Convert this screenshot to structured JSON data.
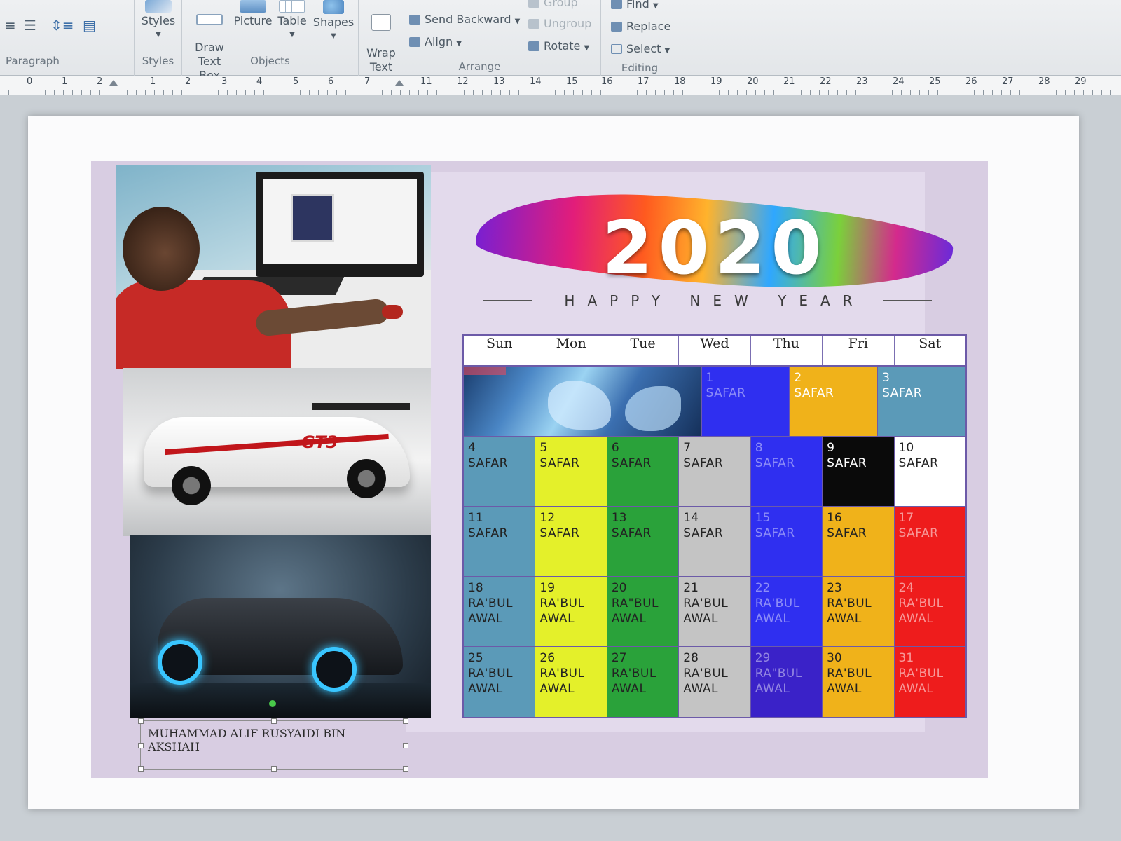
{
  "ribbon": {
    "paragraph": {
      "group_label": "Paragraph"
    },
    "styles": {
      "button_label": "Styles",
      "group_label": "Styles"
    },
    "objects": {
      "group_label": "Objects",
      "buttons": [
        {
          "label": "Draw\nText Box"
        },
        {
          "label": "Picture"
        },
        {
          "label": "Table"
        },
        {
          "label": "Shapes"
        }
      ]
    },
    "arrange": {
      "group_label": "Arrange",
      "wrap_text": "Wrap\nText",
      "send_backward": "Send Backward",
      "align": "Align",
      "group": "Group",
      "ungroup": "Ungroup",
      "rotate": "Rotate"
    },
    "editing": {
      "group_label": "Editing",
      "find": "Find",
      "replace": "Replace",
      "select": "Select"
    }
  },
  "ruler": {
    "numbers": [
      "0",
      "1",
      "2",
      "1",
      "2",
      "3",
      "4",
      "5",
      "6",
      "7",
      "11",
      "12",
      "13",
      "14",
      "15",
      "16",
      "17",
      "18",
      "19",
      "20",
      "21",
      "22",
      "23",
      "24",
      "25",
      "26",
      "27",
      "28",
      "29"
    ]
  },
  "banner": {
    "year": "2020",
    "subtitle": "HAPPY NEW YEAR"
  },
  "name_box": {
    "text": "MUHAMMAD ALIF RUSYAIDI BIN AKSHAH"
  },
  "calendar": {
    "days": [
      "Sun",
      "Mon",
      "Tue",
      "Wed",
      "Thu",
      "Fri",
      "Sat"
    ],
    "first_row": [
      {
        "day": "1",
        "month": "SAFAR",
        "color": "#2f2ff0"
      },
      {
        "day": "2",
        "month": "SAFAR",
        "color": "#f0b21a"
      },
      {
        "day": "3",
        "month": "SAFAR",
        "color": "#5b9ab8"
      }
    ],
    "rows": [
      [
        {
          "day": "4",
          "month": "SAFAR",
          "color": "#5b9ab8"
        },
        {
          "day": "5",
          "month": "SAFAR",
          "color": "#e4f02a"
        },
        {
          "day": "6",
          "month": "SAFAR",
          "color": "#2aa23a"
        },
        {
          "day": "7",
          "month": "SAFAR",
          "color": "#c4c4c4"
        },
        {
          "day": "8",
          "month": "SAFAR",
          "color": "#2f2ff0"
        },
        {
          "day": "9",
          "month": "SAFAR",
          "color": "#0a0a0a"
        },
        {
          "day": "10",
          "month": "SAFAR",
          "color": "#ffffff"
        }
      ],
      [
        {
          "day": "11",
          "month": "SAFAR",
          "color": "#5b9ab8"
        },
        {
          "day": "12",
          "month": "SAFAR",
          "color": "#e4f02a"
        },
        {
          "day": "13",
          "month": "SAFAR",
          "color": "#2aa23a"
        },
        {
          "day": "14",
          "month": "SAFAR",
          "color": "#c4c4c4"
        },
        {
          "day": "15",
          "month": "SAFAR",
          "color": "#2f2ff0"
        },
        {
          "day": "16",
          "month": "SAFAR",
          "color": "#f0b21a"
        },
        {
          "day": "17",
          "month": "SAFAR",
          "color": "#ee1c1c"
        }
      ],
      [
        {
          "day": "18",
          "month": "RA'BUL\nAWAL",
          "color": "#5b9ab8"
        },
        {
          "day": "19",
          "month": "RA'BUL\nAWAL",
          "color": "#e4f02a"
        },
        {
          "day": "20",
          "month": "RA\"BUL\nAWAL",
          "color": "#2aa23a"
        },
        {
          "day": "21",
          "month": "RA'BUL\nAWAL",
          "color": "#c4c4c4"
        },
        {
          "day": "22",
          "month": "RA'BUL\nAWAL",
          "color": "#2f2ff0"
        },
        {
          "day": "23",
          "month": "RA'BUL\nAWAL",
          "color": "#f0b21a"
        },
        {
          "day": "24",
          "month": "RA'BUL\nAWAL",
          "color": "#ee1c1c"
        }
      ],
      [
        {
          "day": "25",
          "month": "RA'BUL\nAWAL",
          "color": "#5b9ab8"
        },
        {
          "day": "26",
          "month": "RA'BUL\nAWAL",
          "color": "#e4f02a"
        },
        {
          "day": "27",
          "month": "RA'BUL\nAWAL",
          "color": "#2aa23a"
        },
        {
          "day": "28",
          "month": "RA'BUL\nAWAL",
          "color": "#c4c4c4"
        },
        {
          "day": "29",
          "month": "RA\"BUL\nAWAL",
          "color": "#3a22c8"
        },
        {
          "day": "30",
          "month": "RA'BUL\nAWAL",
          "color": "#f0b21a"
        },
        {
          "day": "31",
          "month": "RA'BUL\nAWAL",
          "color": "#ee1c1c"
        }
      ]
    ]
  }
}
